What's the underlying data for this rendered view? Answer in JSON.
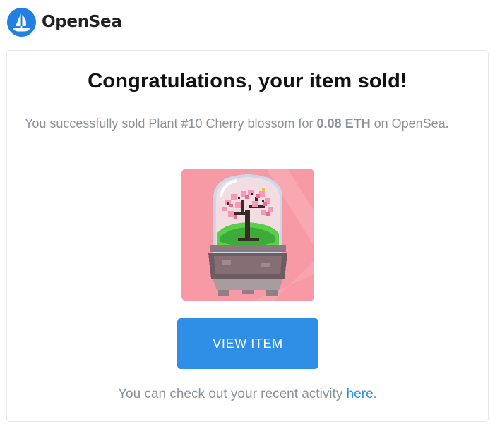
{
  "header": {
    "brand_name": "OpenSea",
    "logo_icon": "opensea-ship-logo-icon",
    "brand_color": "#2081e2"
  },
  "email": {
    "headline": "Congratulations, your item sold!",
    "message_prefix": "You successfully sold Plant #10 Cherry blossom for ",
    "price": "0.08 ETH",
    "message_suffix": " on OpenSea.",
    "image_icon": "cherry-blossom-terrarium-nft-icon",
    "button_label": "VIEW ITEM",
    "button_color": "#2f8ee6",
    "footer_prefix": "You can check out your recent activity ",
    "footer_link": "here",
    "footer_suffix": "."
  }
}
